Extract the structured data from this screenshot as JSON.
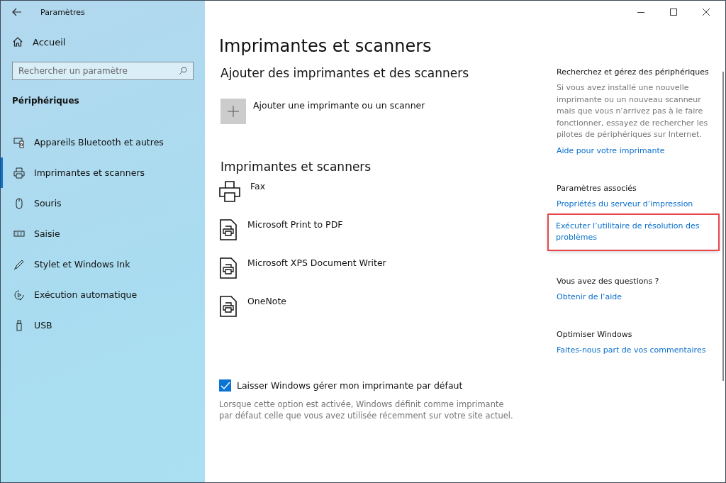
{
  "window": {
    "title": "Paramètres"
  },
  "sidebar": {
    "home": "Accueil",
    "search": {
      "placeholder": "Rechercher un paramètre"
    },
    "section": "Périphériques",
    "items": [
      {
        "label": "Appareils Bluetooth et autres",
        "kind": "devices",
        "selected": false
      },
      {
        "label": "Imprimantes et scanners",
        "kind": "printer",
        "selected": true
      },
      {
        "label": "Souris",
        "kind": "mouse",
        "selected": false
      },
      {
        "label": "Saisie",
        "kind": "keyboard",
        "selected": false
      },
      {
        "label": "Stylet et Windows Ink",
        "kind": "pen",
        "selected": false
      },
      {
        "label": "Exécution automatique",
        "kind": "autoplay",
        "selected": false
      },
      {
        "label": "USB",
        "kind": "usb",
        "selected": false
      }
    ]
  },
  "main": {
    "title": "Imprimantes et scanners",
    "add_heading": "Ajouter des imprimantes et des scanners",
    "add_label": "Ajouter une imprimante ou un scanner",
    "list_heading": "Imprimantes et scanners",
    "printers": [
      {
        "name": "Fax",
        "kind": "fax"
      },
      {
        "name": "Microsoft Print to PDF",
        "kind": "document"
      },
      {
        "name": "Microsoft XPS Document Writer",
        "kind": "document"
      },
      {
        "name": "OneNote",
        "kind": "document"
      }
    ],
    "default_option": {
      "label": "Laisser Windows gérer mon imprimante par défaut",
      "checked": true,
      "description": "Lorsque cette option est activée, Windows définit comme imprimante par défaut celle que vous avez utilisée récemment sur votre site actuel."
    }
  },
  "aside": [
    {
      "heading": "Recherchez et gérez des périphériques",
      "text": "Si vous avez installé une nouvelle imprimante ou un nouveau scanneur mais que vous n’arrivez pas à le faire fonctionner, essayez de rechercher les pilotes de périphériques sur Internet.",
      "links": [
        {
          "label": "Aide pour votre imprimante",
          "highlighted": false
        }
      ]
    },
    {
      "heading": "Paramètres associés",
      "links": [
        {
          "label": "Propriétés du serveur d’impression",
          "highlighted": false
        },
        {
          "label": "Exécuter l’utilitaire de résolution des problèmes",
          "highlighted": true
        }
      ]
    },
    {
      "heading": "Vous avez des questions ?",
      "links": [
        {
          "label": "Obtenir de l’aide",
          "highlighted": false
        }
      ]
    },
    {
      "heading": "Optimiser Windows",
      "links": [
        {
          "label": "Faites-nous part de vos commentaires",
          "highlighted": false
        }
      ]
    }
  ]
}
